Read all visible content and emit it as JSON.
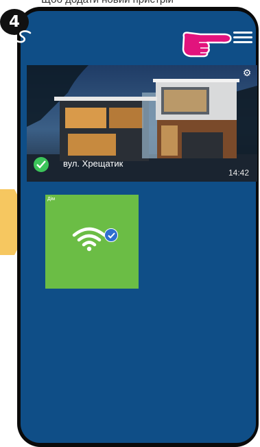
{
  "caption": {
    "text": "Щоб додати новий пристрій"
  },
  "step": {
    "number": "4"
  },
  "header": {
    "logo_icon": "salus-logo-icon",
    "menu_icon": "hamburger-menu-icon"
  },
  "house": {
    "name": "вул. Хрещатик",
    "time": "14:42",
    "status_icon": "check-circle-icon",
    "settings_icon": "gear-icon"
  },
  "tiles": [
    {
      "label": "Дім",
      "icon": "wifi-icon",
      "status": "check-badge-icon",
      "color": "#6bbd45"
    }
  ],
  "colors": {
    "screen_bg": "#0f4e87",
    "tile_green": "#6bbd45",
    "highlight_yellow": "#f6c760",
    "hand_pink": "#e2137d"
  }
}
